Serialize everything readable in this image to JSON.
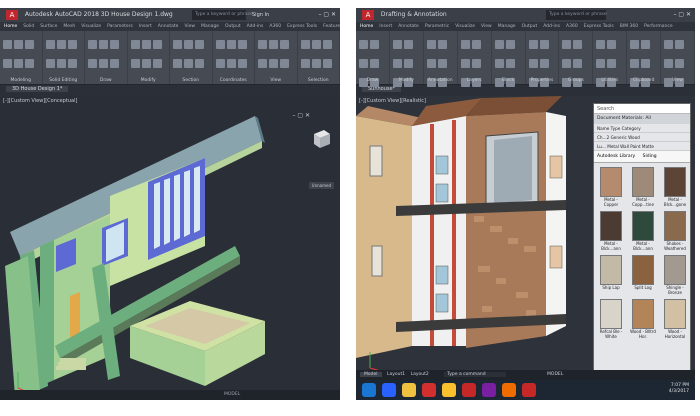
{
  "left": {
    "title": "Autodesk AutoCAD 2018   3D House Design 1.dwg",
    "search_placeholder": "Type a keyword or phrase",
    "signin": "Sign In",
    "tabs": [
      "Home",
      "Solid",
      "Surface",
      "Mesh",
      "Visualize",
      "Parameters",
      "Insert",
      "Annotate",
      "View",
      "Manage",
      "Output",
      "Add-ins",
      "A360",
      "Express Tools",
      "Featured Apps"
    ],
    "groups": [
      "Modeling",
      "Solid Editing",
      "Draw",
      "Modify",
      "Section",
      "Coordinates",
      "View",
      "Selection"
    ],
    "doc_tab": "3D House Design 1*",
    "viewport_label": "[-][Custom View][Conceptual]",
    "viewcube_label": "Unnamed"
  },
  "right": {
    "title": "Drafting & Annotation",
    "search_placeholder": "Type a keyword or phrase",
    "tabs": [
      "Home",
      "Insert",
      "Annotate",
      "Parametric",
      "Visualize",
      "View",
      "Manage",
      "Output",
      "Add-ins",
      "A360",
      "Express Tools",
      "BIM 360",
      "Performance"
    ],
    "groups": [
      "Draw",
      "Modify",
      "Annotation",
      "Layers",
      "Block",
      "Properties",
      "Groups",
      "Utilities",
      "Clipboard",
      "View"
    ],
    "doc_tab": "Sunhouse*",
    "viewport_label": "[-][Custom View][Realistic]",
    "material_browser": {
      "search": "Search",
      "section_title": "Document Materials: All",
      "columns": [
        "Name",
        "Type",
        "Category"
      ],
      "rows": [
        [
          "Ch...2",
          "Generic",
          "Wood"
        ],
        [
          "Lu...",
          "Metal",
          "Wall Paint Matte"
        ]
      ],
      "library": "Autodesk Library",
      "library_filter": "Siding",
      "materials": [
        {
          "name": "Metal - Copper",
          "color": "#b48b6d"
        },
        {
          "name": "Metal - Copp...tine",
          "color": "#9e8a78"
        },
        {
          "name": "Metal - Blck...gone",
          "color": "#5c4436"
        },
        {
          "name": "Metal - Blck...ann",
          "color": "#4b3b33"
        },
        {
          "name": "Metal - Blck...ann",
          "color": "#2d4a3d"
        },
        {
          "name": "Shakes - Weathered",
          "color": "#8a6a4c"
        },
        {
          "name": "Ship Lap",
          "color": "#c2b9a7"
        },
        {
          "name": "Split Log",
          "color": "#8a6240"
        },
        {
          "name": "Shingle - Bronze",
          "color": "#a29a90"
        },
        {
          "name": "Refcal Ble - White",
          "color": "#d9d4c9"
        },
        {
          "name": "Wood - Blltrd Hor.",
          "color": "#b28457"
        },
        {
          "name": "Wood - Horizontal",
          "color": "#d1c0a4"
        }
      ]
    },
    "model_tab": "Model",
    "layout_tabs": [
      "Layout1",
      "Layout2"
    ],
    "command_placeholder": "Type a command",
    "time": "7:07 PM",
    "date": "4/3/2017"
  },
  "status_model": "MODEL"
}
